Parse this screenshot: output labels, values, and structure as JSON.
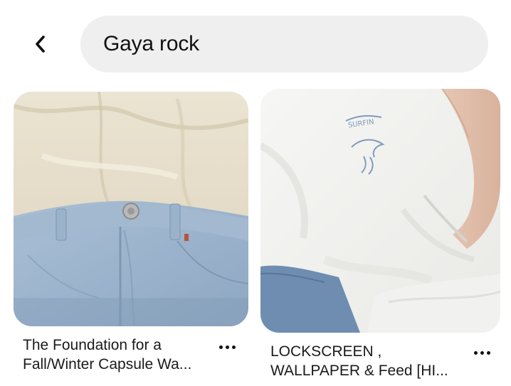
{
  "header": {
    "back_icon": "chevron-left-icon",
    "search_query": "Gaya rock"
  },
  "pins": [
    {
      "title_line1": "The Foundation for a",
      "title_line2": "Fall/Winter Capsule Wa...",
      "image": "cream shirt tucked into light-wash jeans",
      "more_icon": "more-horizontal-icon"
    },
    {
      "title_line1": "LOCKSCREEN ,",
      "title_line2": "WALLPAPER & Feed [HI...",
      "image": "white t-shirt with small surf wave print, denim at bottom",
      "more_icon": "more-horizontal-icon"
    }
  ],
  "colors": {
    "search_bg": "#efefef",
    "text": "#111111"
  }
}
